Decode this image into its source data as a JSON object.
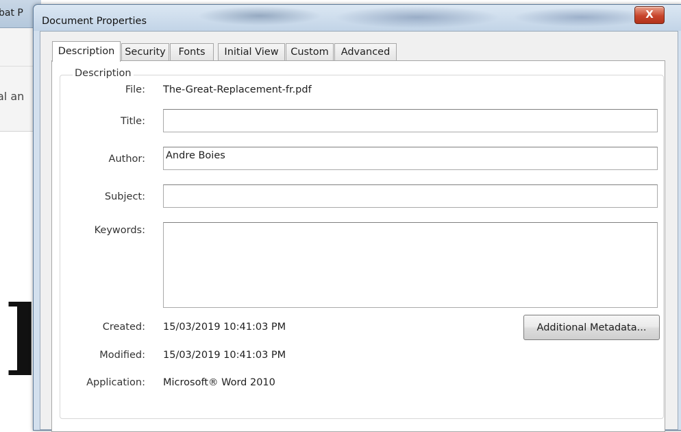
{
  "background_app": {
    "title_fragment": "bat P",
    "toolbar_fragment": "al an"
  },
  "dialog": {
    "title": "Document Properties",
    "close_label": "X"
  },
  "tabs": [
    {
      "label": "Description",
      "active": true
    },
    {
      "label": "Security",
      "active": false
    },
    {
      "label": "Fonts",
      "active": false
    },
    {
      "label": "Initial View",
      "active": false
    },
    {
      "label": "Custom",
      "active": false
    },
    {
      "label": "Advanced",
      "active": false
    }
  ],
  "description": {
    "group_title": "Description",
    "file_label": "File:",
    "file_value": "The-Great-Replacement-fr.pdf",
    "title_label": "Title:",
    "title_value": "",
    "author_label": "Author:",
    "author_value": "Andre Boies",
    "subject_label": "Subject:",
    "subject_value": "",
    "keywords_label": "Keywords:",
    "keywords_value": "",
    "created_label": "Created:",
    "created_value": "15/03/2019 10:41:03 PM",
    "modified_label": "Modified:",
    "modified_value": "15/03/2019 10:41:03 PM",
    "application_label": "Application:",
    "application_value": "Microsoft® Word 2010",
    "metadata_button": "Additional Metadata..."
  }
}
